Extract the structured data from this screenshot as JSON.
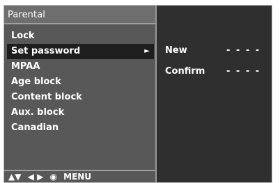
{
  "panel": {
    "title": "Parental"
  },
  "menu": {
    "items": [
      {
        "label": "Lock"
      },
      {
        "label": "Set password",
        "arrow": "►"
      },
      {
        "label": "MPAA"
      },
      {
        "label": "Age block"
      },
      {
        "label": "Content block"
      },
      {
        "label": "Aux. block"
      },
      {
        "label": "Canadian"
      }
    ]
  },
  "footer": {
    "updown": "▲▼",
    "leftright": "◀ ▶",
    "ok": "◉",
    "menu": "MENU"
  },
  "password": {
    "new_label": "New",
    "new_value": "- - - -",
    "confirm_label": "Confirm",
    "confirm_value": "- - - -"
  }
}
